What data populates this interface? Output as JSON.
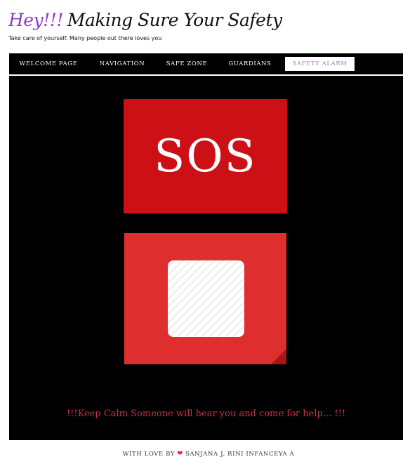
{
  "header": {
    "title_hey": "Hey!!!",
    "title_main": "Making Sure Your Safety",
    "tagline": "Take care of yourself. Many people out there loves you"
  },
  "nav": {
    "items": [
      {
        "label": "Welcome Page"
      },
      {
        "label": "Navigation"
      },
      {
        "label": "Safe Zone"
      },
      {
        "label": "Guardians"
      },
      {
        "label": "Safety Alarm"
      }
    ],
    "active": "Safety Alarm"
  },
  "main": {
    "sos_label": "SOS",
    "stop_icon": "stop-icon",
    "message": "!!!Keep Calm Someone will hear you and come for help... !!!"
  },
  "footer": {
    "prefix": "With love by",
    "heart_icon": "heart-icon",
    "authors": "Sanjana J, Rini Infanceya A"
  },
  "colors": {
    "accent_purple": "#8a3cc8",
    "sos_red": "#cc1016",
    "stop_red": "#df2e2e",
    "message_red": "#d22b4a"
  }
}
